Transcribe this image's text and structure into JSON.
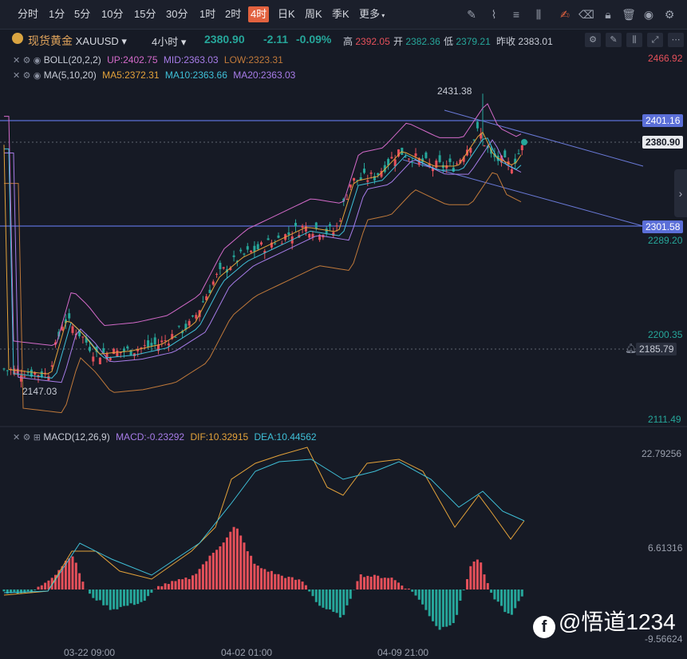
{
  "timeframes": [
    "分时",
    "1分",
    "5分",
    "10分",
    "15分",
    "30分",
    "1时",
    "2时",
    "4时",
    "日K",
    "周K",
    "季K",
    "更多"
  ],
  "active_timeframe": "4时",
  "symbol": {
    "name": "现货黄金",
    "code": "XAUUSD",
    "period": "4小时",
    "price": "2380.90",
    "change": "-2.11",
    "change_pct": "-0.09%",
    "high_label": "高",
    "high": "2392.05",
    "open_label": "开",
    "open": "2382.36",
    "low_label": "低",
    "low": "2379.21",
    "prev_close_label": "昨收",
    "prev_close": "2383.01"
  },
  "indicators": {
    "boll": {
      "label": "BOLL(20,2,2)",
      "up": "UP:2402.75",
      "mid": "MID:2363.03",
      "low": "LOW:2323.31"
    },
    "ma": {
      "label": "MA(5,10,20)",
      "ma5": "MA5:2372.31",
      "ma10": "MA10:2363.66",
      "ma20": "MA20:2363.03"
    },
    "macd": {
      "label": "MACD(12,26,9)",
      "macd": "MACD:-0.23292",
      "dif": "DIF:10.32915",
      "dea": "DEA:10.44562"
    }
  },
  "price_axis": {
    "labels": [
      "2466.92",
      "2401.16",
      "2380.90",
      "2301.58",
      "2289.20",
      "2200.35",
      "2185.79",
      "2111.49"
    ],
    "hline_high": "2401.16",
    "hline_low": "2301.58",
    "current": "2380.90",
    "alert": "2185.79"
  },
  "macd_axis": [
    "22.79256",
    "6.61316",
    "-9.56624"
  ],
  "annotations": {
    "peak": "2431.38",
    "trough": "2147.03"
  },
  "time_axis": [
    "03-22 09:00",
    "04-02 01:00",
    "04-09 21:00"
  ],
  "watermark": "@悟道1234",
  "colors": {
    "up": "#e5505a",
    "down": "#26a69a",
    "accent": "#e2623f",
    "line": "#5b6fd8",
    "ma5": "#e3a23a",
    "ma10": "#3fc0d8",
    "ma20": "#a77ce8",
    "boll_up": "#d36ac9",
    "boll_low": "#c0793a"
  }
}
